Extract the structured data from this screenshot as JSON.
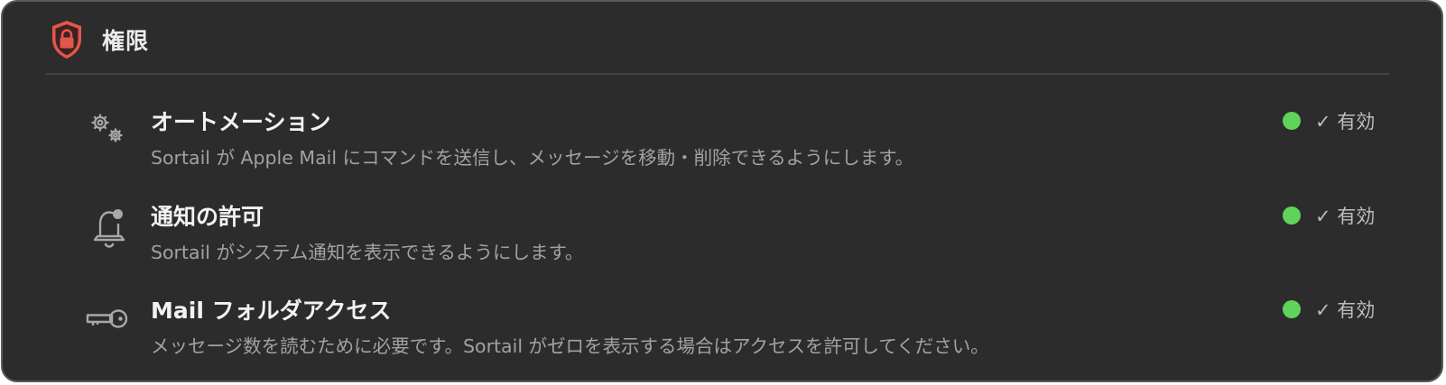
{
  "header": {
    "title": "権限",
    "icon": "lock-shield-icon",
    "accent": "#e5564a"
  },
  "permissions": [
    {
      "icon": "gears-icon",
      "title": "オートメーション",
      "description": "Sortail が Apple Mail にコマンドを送信し、メッセージを移動・削除できるようにします。",
      "status": "✓ 有効",
      "status_color": "#5fd35a"
    },
    {
      "icon": "bell-badge-icon",
      "title": "通知の許可",
      "description": "Sortail がシステム通知を表示できるようにします。",
      "status": "✓ 有効",
      "status_color": "#5fd35a"
    },
    {
      "icon": "key-icon",
      "title": "Mail フォルダアクセス",
      "description": "メッセージ数を読むために必要です。Sortail がゼロを表示する場合はアクセスを許可してください。",
      "status": "✓ 有効",
      "status_color": "#5fd35a"
    }
  ]
}
